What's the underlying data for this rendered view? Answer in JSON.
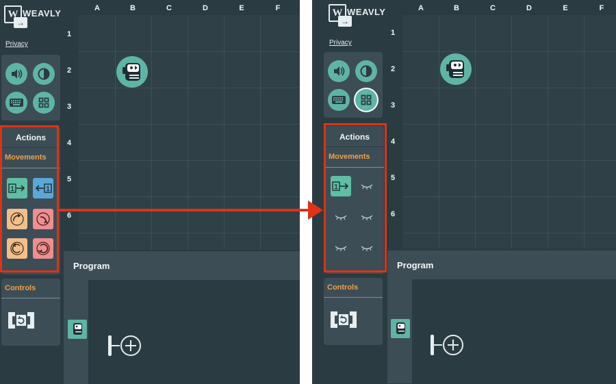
{
  "app": {
    "logo_text": "WEAVLY",
    "logo_letter": "W",
    "privacy_label": "Privacy"
  },
  "grid": {
    "columns": [
      "A",
      "B",
      "C",
      "D",
      "E",
      "F"
    ],
    "rows": [
      "1",
      "2",
      "3",
      "4",
      "5",
      "6"
    ]
  },
  "actions": {
    "title": "Actions",
    "category": "Movements"
  },
  "controls": {
    "title": "Controls"
  },
  "program": {
    "title": "Program"
  },
  "icons": {
    "sound": "speaker-icon",
    "contrast": "contrast-icon",
    "keyboard": "keyboard-icon",
    "grid": "grid-icon",
    "forward": "move-forward-1-icon",
    "backward": "move-backward-1-icon",
    "turn_left": "turn-left-icon",
    "turn_right": "turn-right-icon",
    "hidden": "closed-eye-icon",
    "loop": "repeat-loop-icon",
    "add": "add-icon",
    "robot": "robot-icon"
  },
  "colors": {
    "background": "#2b3b42",
    "panel": "#3c4d55",
    "accent_teal": "#5fb5a5",
    "accent_orange": "#f0a04a",
    "highlight_red": "#e03215"
  }
}
